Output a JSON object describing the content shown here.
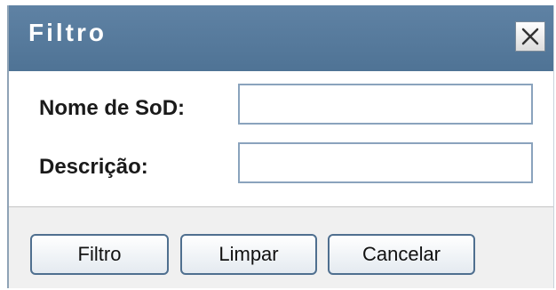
{
  "dialog": {
    "title": "Filtro",
    "close_icon": "close-x-icon"
  },
  "form": {
    "sod_name_label": "Nome de SoD:",
    "sod_name_value": "",
    "description_label": "Descrição:",
    "description_value": ""
  },
  "buttons": {
    "filter_label": "Filtro",
    "clear_label": "Limpar",
    "cancel_label": "Cancelar"
  },
  "colors": {
    "titlebar": "#5b7fa0",
    "input_border": "#8aa3bd",
    "button_border": "#4f6f8f",
    "footer_bg": "#f0f0f0"
  }
}
